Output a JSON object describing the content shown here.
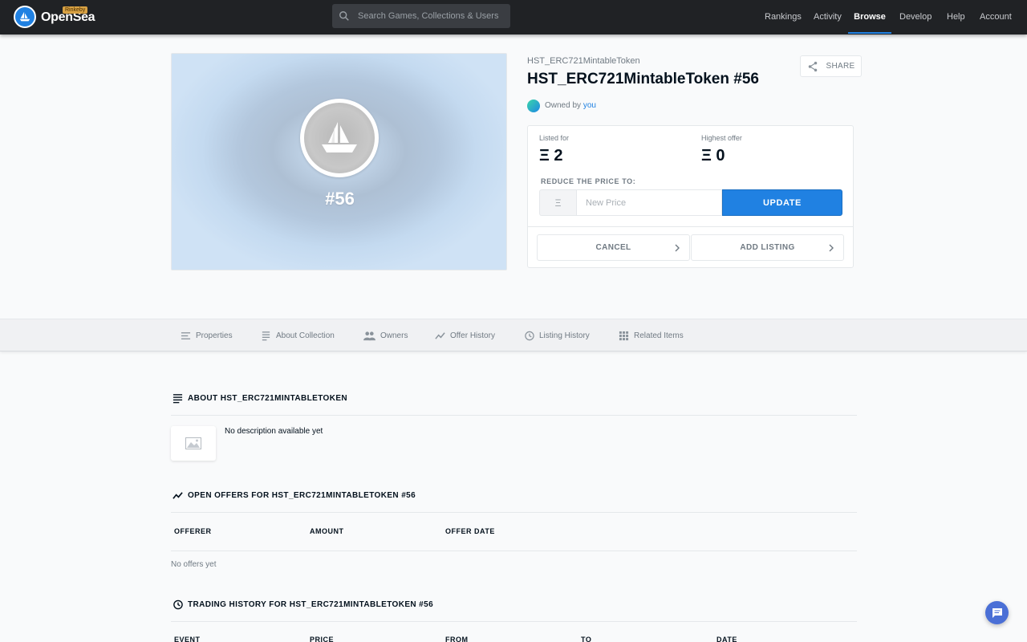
{
  "nav": {
    "brand": "OpenSea",
    "badge": "Rinkeby",
    "search_placeholder": "Search Games, Collections & Users",
    "links": [
      {
        "label": "Rankings",
        "active": false
      },
      {
        "label": "Activity",
        "active": false
      },
      {
        "label": "Browse",
        "active": true
      },
      {
        "label": "Develop",
        "active": false
      },
      {
        "label": "Help",
        "active": false
      },
      {
        "label": "Account",
        "active": false
      }
    ]
  },
  "asset": {
    "art_label": "#56",
    "collection": "HST_ERC721MintableToken",
    "title": "HST_ERC721MintableToken #56",
    "owned_by_prefix": "Owned by",
    "owner": "you",
    "share_label": "SHARE"
  },
  "pricing": {
    "listed_label": "Listed for",
    "listed_value": "Ξ 2",
    "offer_label": "Highest offer",
    "offer_value": "Ξ 0",
    "reduce_label": "REDUCE THE PRICE TO:",
    "currency_symbol": "Ξ",
    "price_placeholder": "New Price",
    "update_label": "UPDATE",
    "cancel_label": "CANCEL",
    "add_listing_label": "ADD LISTING"
  },
  "tabs": [
    {
      "label": "Properties",
      "icon": "list-icon"
    },
    {
      "label": "About Collection",
      "icon": "notes-icon"
    },
    {
      "label": "Owners",
      "icon": "people-icon"
    },
    {
      "label": "Offer History",
      "icon": "trend-icon"
    },
    {
      "label": "Listing History",
      "icon": "history-icon"
    },
    {
      "label": "Related Items",
      "icon": "grid-icon"
    }
  ],
  "about": {
    "heading": "ABOUT HST_ERC721MINTABLETOKEN",
    "description": "No description available yet"
  },
  "offers": {
    "heading": "OPEN OFFERS FOR HST_ERC721MINTABLETOKEN #56",
    "columns": [
      "OFFERER",
      "AMOUNT",
      "OFFER DATE"
    ],
    "empty": "No offers yet"
  },
  "trading": {
    "heading": "TRADING HISTORY FOR HST_ERC721MINTABLETOKEN #56",
    "columns": [
      "EVENT",
      "PRICE",
      "FROM",
      "TO",
      "DATE"
    ]
  },
  "colors": {
    "accent": "#2081e2",
    "navbar": "#202225",
    "chat": "#4a6fd6"
  }
}
